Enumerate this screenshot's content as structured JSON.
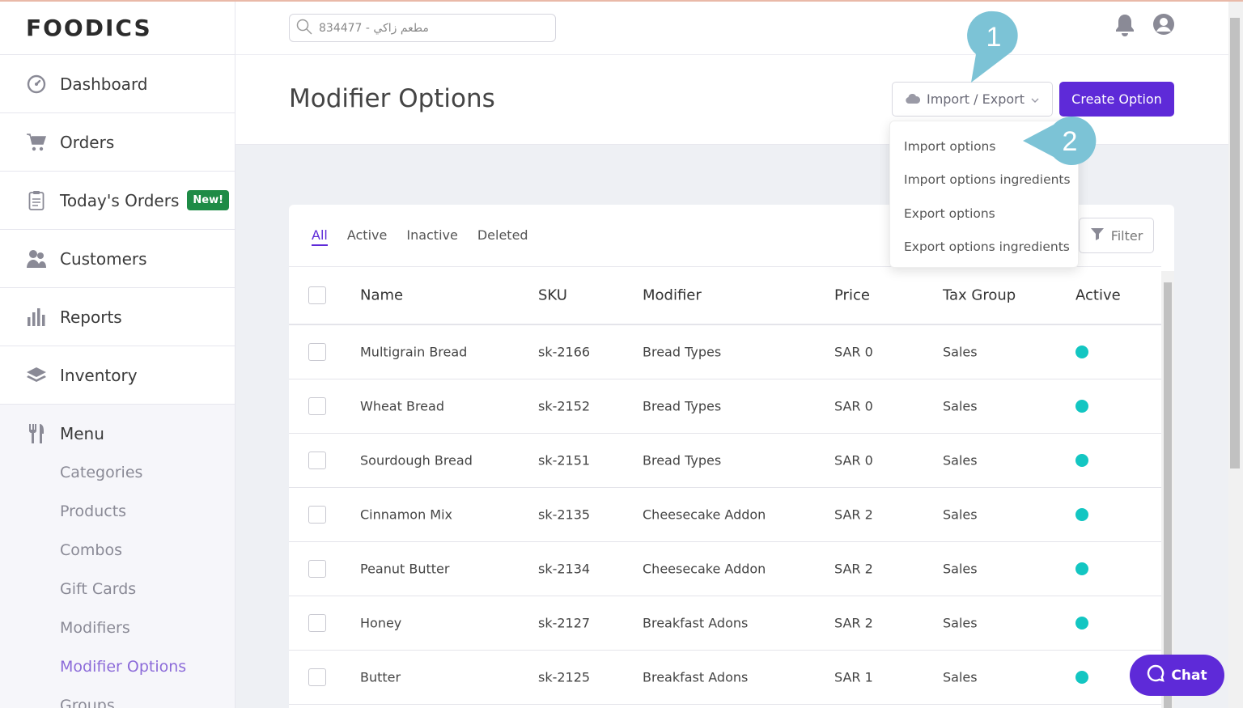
{
  "app": {
    "logo": "FOODICS"
  },
  "sidebar": {
    "items": [
      {
        "label": "Dashboard",
        "icon": "dashboard-icon"
      },
      {
        "label": "Orders",
        "icon": "cart-icon"
      },
      {
        "label": "Today's Orders",
        "icon": "clipboard-icon",
        "badge": "New!"
      },
      {
        "label": "Customers",
        "icon": "customers-icon"
      },
      {
        "label": "Reports",
        "icon": "bar-chart-icon"
      },
      {
        "label": "Inventory",
        "icon": "layers-icon"
      }
    ],
    "menu": {
      "label": "Menu",
      "icon": "cutlery-icon",
      "sub": [
        "Categories",
        "Products",
        "Combos",
        "Gift Cards",
        "Modifiers",
        "Modifier Options",
        "Groups"
      ],
      "active": "Modifier Options"
    }
  },
  "topbar": {
    "search_value": "مطعم زاكي - 834477"
  },
  "header": {
    "title": "Modifier Options",
    "import_export_label": "Import / Export",
    "create_label": "Create Option"
  },
  "dropdown": {
    "items": [
      "Import options",
      "Import options ingredients",
      "Export options",
      "Export options ingredients"
    ]
  },
  "markers": {
    "one": "1",
    "two": "2"
  },
  "tabs": [
    "All",
    "Active",
    "Inactive",
    "Deleted"
  ],
  "filter_label": "Filter",
  "table": {
    "columns": [
      "Name",
      "SKU",
      "Modifier",
      "Price",
      "Tax Group",
      "Active"
    ],
    "rows": [
      [
        "Multigrain Bread",
        "sk-2166",
        "Bread Types",
        "SAR 0",
        "Sales"
      ],
      [
        "Wheat Bread",
        "sk-2152",
        "Bread Types",
        "SAR 0",
        "Sales"
      ],
      [
        "Sourdough Bread",
        "sk-2151",
        "Bread Types",
        "SAR 0",
        "Sales"
      ],
      [
        "Cinnamon Mix",
        "sk-2135",
        "Cheesecake Addon",
        "SAR 2",
        "Sales"
      ],
      [
        "Peanut Butter",
        "sk-2134",
        "Cheesecake Addon",
        "SAR 2",
        "Sales"
      ],
      [
        "Honey",
        "sk-2127",
        "Breakfast Adons",
        "SAR 2",
        "Sales"
      ],
      [
        "Butter",
        "sk-2125",
        "Breakfast Adons",
        "SAR 1",
        "Sales"
      ]
    ]
  },
  "chat_label": "Chat",
  "colors": {
    "accent": "#5e2ad8",
    "active_dot": "#13c6c2",
    "new_badge": "#1e8b46",
    "marker": "#7cc3d6"
  }
}
